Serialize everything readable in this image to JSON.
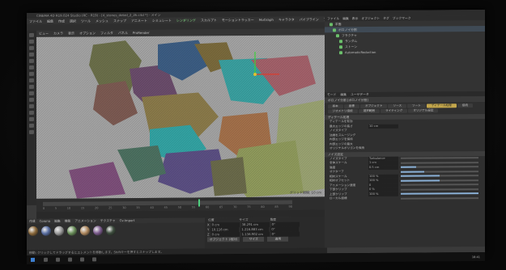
{
  "window": {
    "title": "CINEMA 4D R19.024 Studio (RC - R19) - [4_stones_detail_2_2k.c4d *] - メイン"
  },
  "menubar": {
    "items": [
      "ファイル",
      "編集",
      "作成",
      "選択",
      "ツール",
      "メッシュ",
      "スナップ",
      "アニメート",
      "シミュレート",
      "レンダリング",
      "スカルプト",
      "モーショントラッカー",
      "MoGraph",
      "キャラクタ",
      "パイプライン",
      "プラグイン",
      "スクリプト"
    ],
    "highlighted": "レンダリング"
  },
  "viewport": {
    "menu": [
      "ビュー",
      "カメラ",
      "表示",
      "オプション",
      "フィルタ",
      "パネル",
      "ProRender"
    ],
    "grid_label": "グリッド間隔: 10 cm"
  },
  "timeline": {
    "ticks": [
      "0",
      "5",
      "10",
      "15",
      "20",
      "25",
      "30",
      "35",
      "40",
      "45",
      "50",
      "55",
      "60",
      "65",
      "70",
      "75",
      "80",
      "85",
      "90"
    ],
    "frame": "0 F",
    "end": "90 F"
  },
  "material_manager": {
    "menu": [
      "作成",
      "Corona",
      "編集",
      "機能",
      "アニメーション",
      "テクスチャ",
      "Cv-Import"
    ],
    "materials": [
      "#8c6a3c",
      "#5a6fa3",
      "#9a9a9a",
      "#6a8f5a",
      "#b08a60",
      "#7d5d8f",
      "#3f4f3f"
    ]
  },
  "coordinates": {
    "headers": [
      "位置",
      "サイズ",
      "角度"
    ],
    "rows": [
      {
        "axis": "X",
        "pos": "0 cm",
        "size": "38.291 cm",
        "rot": "0°"
      },
      {
        "axis": "Y",
        "pos": "10.116 cm",
        "size": "1.216.883 cm",
        "rot": "0°"
      },
      {
        "axis": "Z",
        "pos": "0 cm",
        "size": "1.136.902 cm",
        "rot": "0°"
      }
    ],
    "mode": "オブジェクト (相対)",
    "size_mode": "サイズ",
    "apply": "適用"
  },
  "status": {
    "text": "移動: クリックしてドラッグするとエレメントを移動します。Shiftキーを押すとスナップします。"
  },
  "object_manager": {
    "menu": [
      "ファイル",
      "編集",
      "表示",
      "オブジェクト",
      "タグ",
      "ブックマーク"
    ],
    "objects": [
      "平面",
      "ボロノイ分割",
      "フラクチャ",
      "ランダム",
      "ストーン",
      "AutomaticReduction"
    ]
  },
  "attribute_manager": {
    "menu": [
      "モード",
      "編集",
      "ユーザデータ"
    ],
    "title": "ボロノイ分割 [ボロノイ分割]",
    "tabs": [
      "基本",
      "座標",
      "オブジェクト",
      "ソース",
      "ソート",
      "ディテール処理",
      "接続",
      "ジオメトリ接続",
      "選択範囲",
      "ライティング",
      "オリジナル設定"
    ],
    "active_tab": "ディテール処理",
    "section1": "ディテール処理",
    "attrs": [
      {
        "label": "ディテールを有効",
        "value": ""
      },
      {
        "label": "最大エッジの長さ",
        "value": "10 cm"
      },
      {
        "label": "ノイズタイプ",
        "value": ""
      },
      {
        "label": "法線をスムージング",
        "value": ""
      },
      {
        "label": "内部エッジを保持",
        "value": ""
      },
      {
        "label": "内部エッジの最大",
        "value": ""
      },
      {
        "label": "オリジナルポリゴンを保持",
        "value": ""
      }
    ],
    "section2": "ノイズ設定",
    "noise": [
      {
        "label": "ノイズタイプ",
        "value": "Turbulence",
        "level": 0.0
      },
      {
        "label": "全体スケール",
        "value": "1 cm",
        "level": 0.0
      },
      {
        "label": "強度",
        "value": "0.5 cm",
        "level": 0.2
      },
      {
        "label": "オクターブ",
        "value": "",
        "level": 0.3
      },
      {
        "label": "相対スケール",
        "value": "100 %",
        "level": 0.5
      },
      {
        "label": "相対オフセット",
        "value": "100 %",
        "level": 0.5
      },
      {
        "label": "アニメーション速度",
        "value": "0",
        "level": 0.0
      },
      {
        "label": "下部クリップ",
        "value": "0 %",
        "level": 0.0
      },
      {
        "label": "上部クリップ",
        "value": "100 %",
        "level": 1.0
      },
      {
        "label": "ローカル座標",
        "value": "",
        "level": 0.0
      }
    ]
  },
  "taskbar": {
    "clock": "18:41"
  }
}
